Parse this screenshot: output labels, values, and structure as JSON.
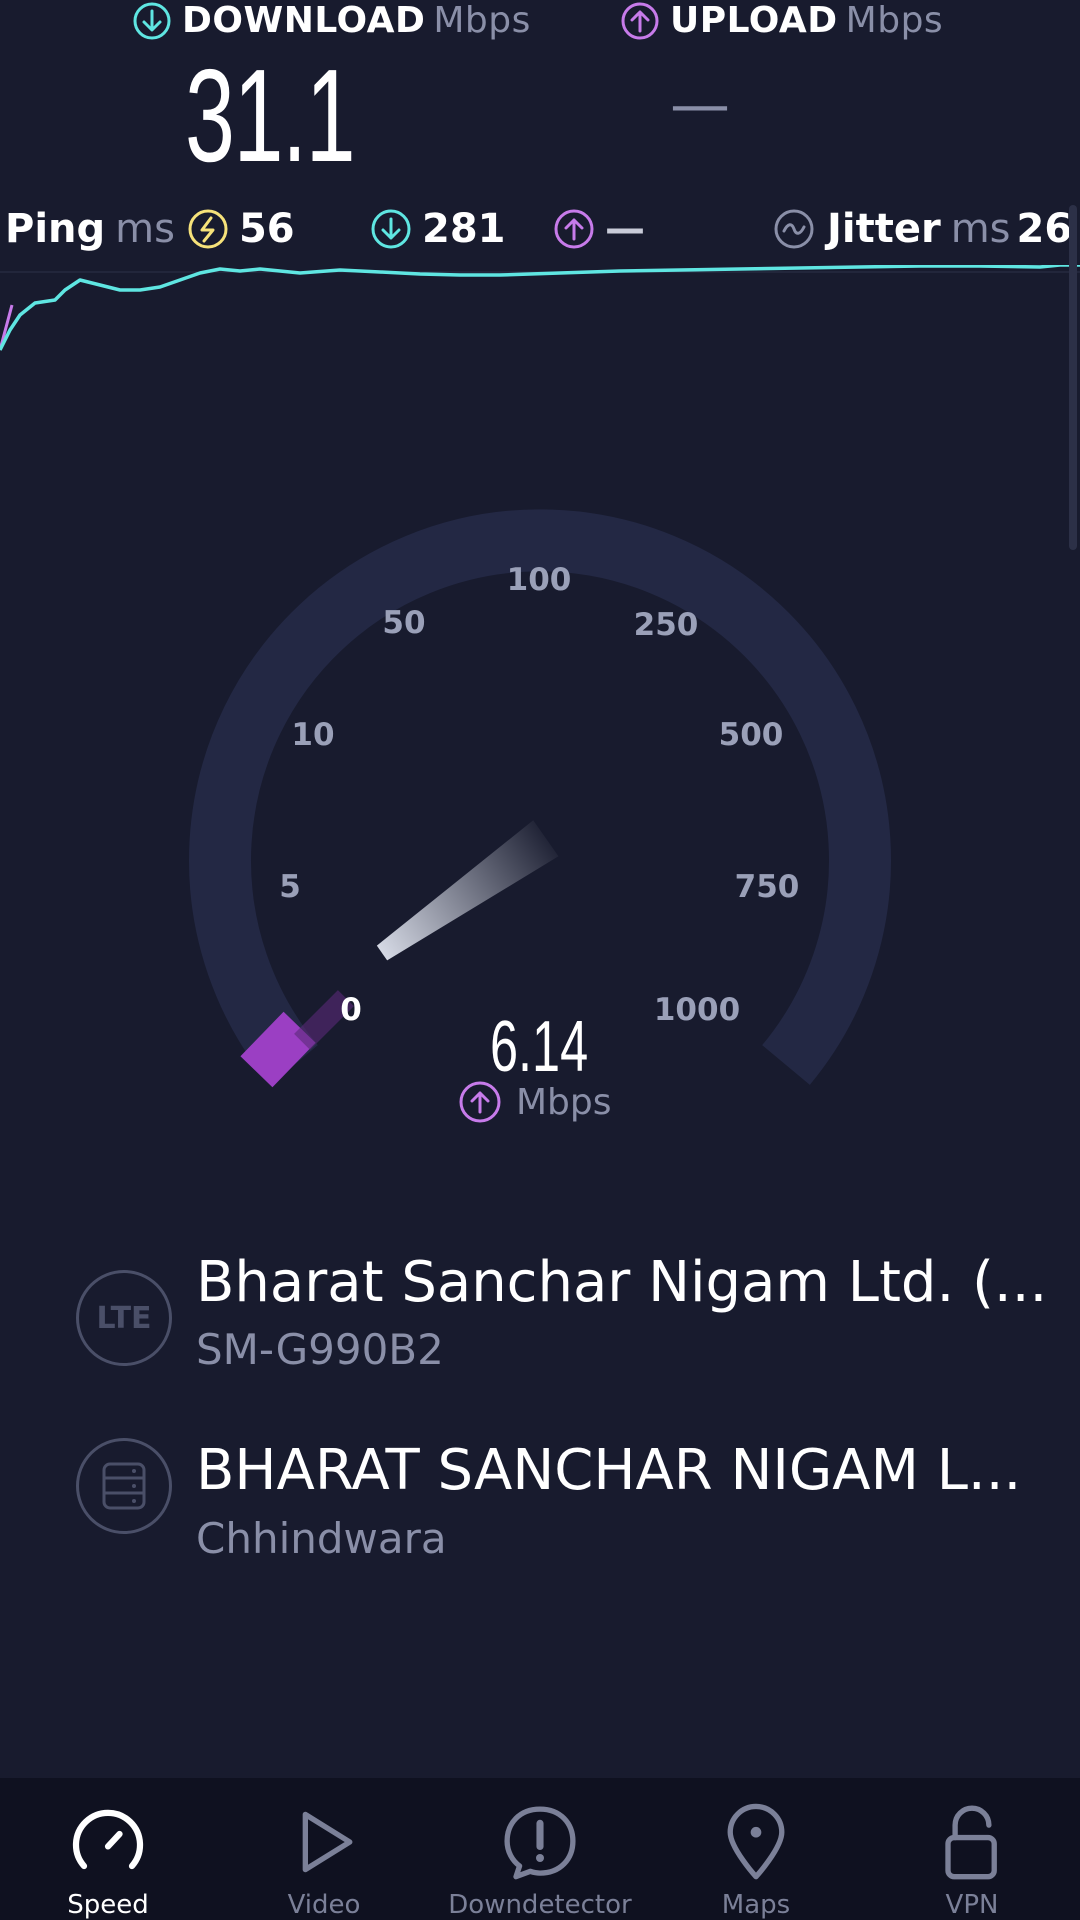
{
  "header": {
    "download_label": "DOWNLOAD",
    "download_unit": "Mbps",
    "upload_label": "UPLOAD",
    "upload_unit": "Mbps",
    "download_value": "31.1",
    "upload_value": "—"
  },
  "stats": {
    "ping_label": "Ping",
    "ping_unit": "ms",
    "ping_idle": "56",
    "ping_download": "281",
    "ping_upload": "—",
    "jitter_label": "Jitter",
    "jitter_unit": "ms",
    "jitter_value": "26"
  },
  "gauge": {
    "ticks": [
      "0",
      "5",
      "10",
      "50",
      "100",
      "250",
      "500",
      "750",
      "1000"
    ],
    "current_value": "6.14",
    "current_unit": "Mbps",
    "accent_color": "#9b3fc3",
    "needle_color": "#dfe3ee"
  },
  "connection": {
    "provider_name": "Bharat Sanchar Nigam Ltd. (...",
    "device": "SM-G990B2",
    "network_badge": "LTE",
    "server_name": "BHARAT SANCHAR NIGAM L...",
    "server_location": "Chhindwara"
  },
  "colors": {
    "download": "#5fe6e2",
    "upload": "#c77bea",
    "ping": "#f6e27a",
    "background": "#181b2e"
  },
  "nav": {
    "items": [
      {
        "label": "Speed",
        "icon": "speedometer-icon",
        "active": true
      },
      {
        "label": "Video",
        "icon": "play-icon",
        "active": false
      },
      {
        "label": "Downdetector",
        "icon": "alert-icon",
        "active": false
      },
      {
        "label": "Maps",
        "icon": "map-pin-icon",
        "active": false
      },
      {
        "label": "VPN",
        "icon": "lock-icon",
        "active": false
      }
    ]
  }
}
